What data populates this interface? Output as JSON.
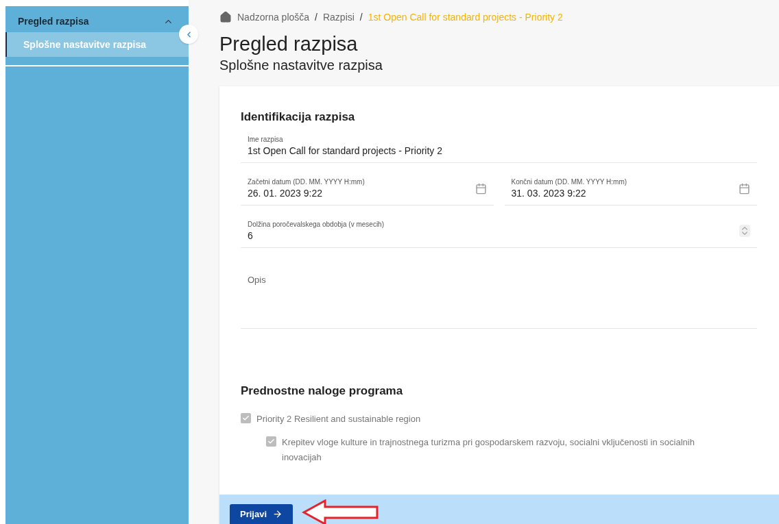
{
  "sidebar": {
    "title": "Pregled razpisa",
    "expanded": true,
    "items": [
      {
        "label": "Splošne nastavitve razpisa",
        "selected": true
      }
    ]
  },
  "breadcrumb_separator": "/",
  "breadcrumb": [
    {
      "label": "Nadzorna plošča",
      "current": false
    },
    {
      "label": "Razpisi",
      "current": false
    },
    {
      "label": "1st Open Call for standard projects - Priority 2",
      "current": true
    }
  ],
  "page_title": "Pregled razpisa",
  "page_subtitle": "Splošne nastavitve razpisa",
  "identification": {
    "heading": "Identifikacija razpisa",
    "rows": [
      [
        {
          "kind": "text",
          "label": "Ime razpisa",
          "value": "1st Open Call for standard projects - Priority 2"
        }
      ],
      [
        {
          "kind": "date",
          "label": "Začetni datum (DD. MM. YYYY H:mm)",
          "value": "26. 01. 2023 9:22"
        },
        {
          "kind": "date",
          "label": "Končni datum (DD. MM. YYYY H:mm)",
          "value": "31. 03. 2023 9:22"
        }
      ],
      [
        {
          "kind": "number",
          "label": "Dolžina poročevalskega obdobja (v mesecih)",
          "value": "6"
        }
      ],
      [
        {
          "kind": "textarea",
          "placeholder": "Opis"
        }
      ]
    ]
  },
  "priorities": {
    "heading": "Prednostne naloge programa",
    "items": [
      {
        "label": "Priority 2 Resilient and sustainable region",
        "checked": true,
        "disabled": true,
        "children": [
          {
            "label": "Krepitev vloge kulture in trajnostnega turizma pri gospodarskem razvoju, socialni vključenosti in socialnih inovacijah",
            "checked": true,
            "disabled": true
          }
        ]
      }
    ]
  },
  "submit_button": "Prijavi"
}
